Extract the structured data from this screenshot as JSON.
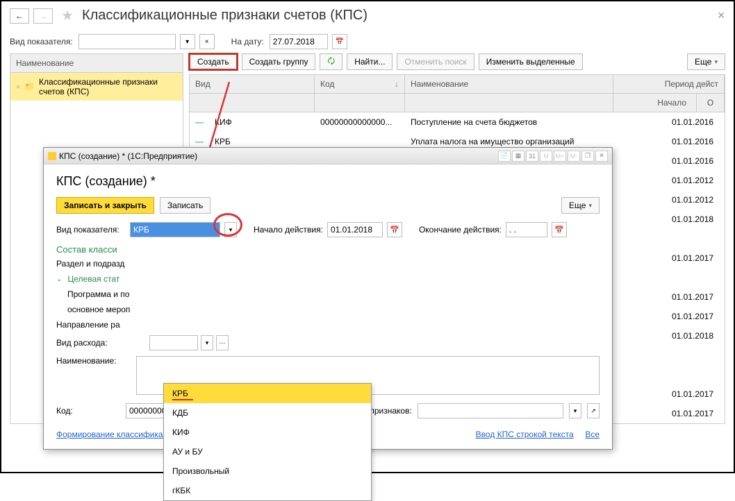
{
  "header": {
    "title": "Классификационные признаки счетов (КПС)"
  },
  "filters": {
    "vid_label": "Вид показателя:",
    "date_label": "На дату:",
    "date_value": "27.07.2018"
  },
  "sidebar": {
    "header": "Наименование",
    "item": "Классификационные признаки счетов (КПС)"
  },
  "toolbar": {
    "create": "Создать",
    "create_group": "Создать группу",
    "find": "Найти...",
    "cancel_search": "Отменить поиск",
    "change_selected": "Изменить выделенные",
    "more": "Еще"
  },
  "columns": {
    "vid": "Вид",
    "kod": "Код",
    "name": "Наименование",
    "period": "Период дейст",
    "start": "Начало",
    "end": "О"
  },
  "rows": [
    {
      "vid": "КИФ",
      "kod": "00000000000000...",
      "name": "Поступление на счета бюджетов",
      "date": "01.01.2016"
    },
    {
      "vid": "КРБ",
      "kod": "",
      "name": "Уплата налога на имущество организаций",
      "date": "01.01.2016"
    },
    {
      "vid": "",
      "kod": "",
      "name": "",
      "date": "01.01.2016"
    },
    {
      "vid": "",
      "kod": "",
      "name": "",
      "date": "01.01.2012"
    },
    {
      "vid": "",
      "kod": "",
      "name": "",
      "date": "01.01.2012"
    },
    {
      "vid": "",
      "kod": "",
      "name": "",
      "date": "01.01.2018"
    },
    {
      "vid": "",
      "kod": "",
      "name": "",
      "date": ""
    },
    {
      "vid": "",
      "kod": "",
      "name": "",
      "date": "01.01.2017"
    },
    {
      "vid": "",
      "kod": "",
      "name": "",
      "date": ""
    },
    {
      "vid": "",
      "kod": "",
      "name": "",
      "date": "01.01.2017"
    },
    {
      "vid": "",
      "kod": "",
      "name": "",
      "date": "01.01.2017"
    },
    {
      "vid": "",
      "kod": "",
      "name": "",
      "date": "01.01.2018"
    },
    {
      "vid": "",
      "kod": "",
      "name": "",
      "date": ""
    },
    {
      "vid": "",
      "kod": "",
      "name": "",
      "date": ""
    },
    {
      "vid": "",
      "kod": "",
      "name": "",
      "date": "01.01.2017"
    },
    {
      "vid": "",
      "kod": "",
      "name": "",
      "date": "01.01.2017"
    }
  ],
  "modal": {
    "window_title": "КПС (создание) * (1С:Предприятие)",
    "title": "КПС (создание) *",
    "save_close": "Записать и закрыть",
    "save": "Записать",
    "more": "Еще",
    "vid_label": "Вид показателя:",
    "vid_value": "КРБ",
    "start_label": "Начало действия:",
    "start_value": "01.01.2018",
    "end_label": "Окончание действия:",
    "end_value": ". .",
    "section": "Состав класси",
    "razdel": "Раздел и подразд",
    "target": "Целевая стат",
    "program": "Программа и по",
    "main_event": "основное мероп",
    "direction": "Направление ра",
    "expense_type": "Вид расхода:",
    "name_label": "Наименование:",
    "code_label": "Код:",
    "code_value": "00000000000000000",
    "group_label": "Группа классификационных признаков:",
    "link1": "Формирование классификационных признаков счетов",
    "link2": "Ввод КПС строкой текста",
    "all": "Все"
  },
  "dropdown": {
    "items": [
      "КРБ",
      "КДБ",
      "КИФ",
      "АУ и БУ",
      "Произвольный",
      "гКБК"
    ]
  },
  "titlebar_icons": [
    "M",
    "M+",
    "M-"
  ]
}
